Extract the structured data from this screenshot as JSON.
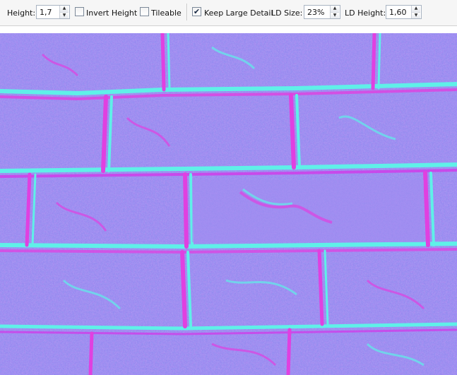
{
  "toolbar": {
    "height_label": "Height:",
    "height_value": "1,7",
    "invert_height_label": "Invert Height",
    "invert_height_checked": false,
    "tileable_label": "Tileable",
    "tileable_checked": false,
    "keep_large_detail_label": "Keep Large Detail",
    "keep_large_detail_checked": true,
    "ld_size_label": "LD Size:",
    "ld_size_value": "23%",
    "ld_height_label": "LD Height:",
    "ld_height_value": "1,60"
  },
  "canvas": {
    "base_color": "#8a7bf0",
    "highlight_color": "#5ff0e8",
    "shadow_color": "#e040e0"
  }
}
